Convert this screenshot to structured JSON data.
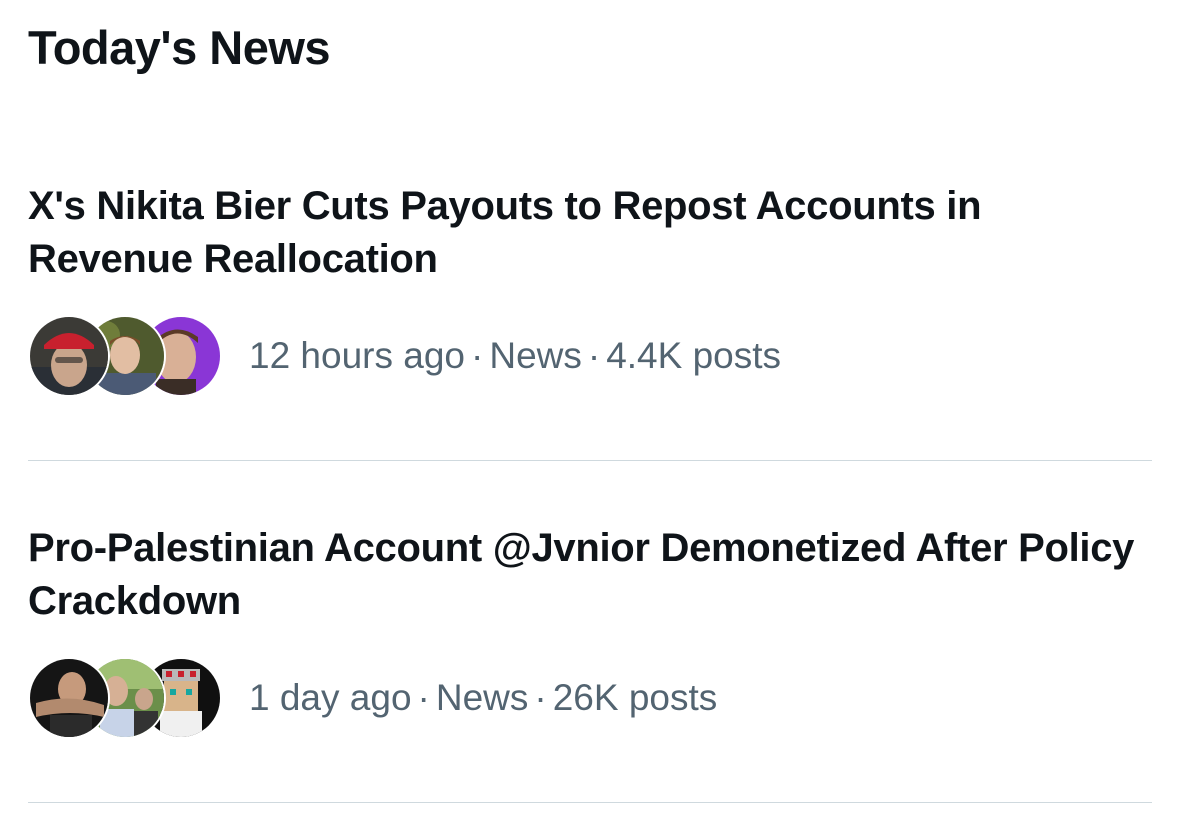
{
  "section": {
    "title": "Today's News"
  },
  "stories": [
    {
      "headline": "X's Nikita Bier Cuts Payouts to Repost Accounts in Revenue Reallocation",
      "time": "12 hours ago",
      "category": "News",
      "posts": "4.4K posts",
      "separator": "·"
    },
    {
      "headline": "Pro-Palestinian Account @Jvnior Demonetized After Policy Crackdown",
      "time": "1 day ago",
      "category": "News",
      "posts": "26K posts",
      "separator": "·"
    }
  ],
  "colors": {
    "text_primary": "#0f1419",
    "text_secondary": "#536471",
    "divider": "#cfd9de"
  }
}
